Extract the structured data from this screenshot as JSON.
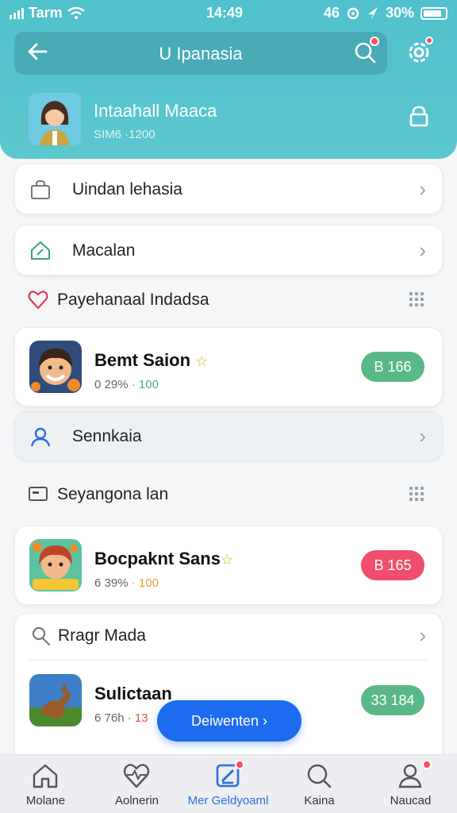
{
  "status_bar": {
    "carrier": "Tarm",
    "time": "14:49",
    "left_glyph": "46",
    "battery": "30%"
  },
  "header": {
    "title": "U Ipanasia"
  },
  "profile": {
    "name": "Intaahall Maaca",
    "sub": "SIM6 ·1200"
  },
  "menu": [
    {
      "label": "Uindan lehasia"
    },
    {
      "label": "Macalan"
    }
  ],
  "section_favorites": {
    "label": "Payehanaal Indadsa"
  },
  "app1": {
    "name": "Bemt Saion",
    "meta_pct": "0 29%",
    "meta_sep": "·",
    "meta_count": "100",
    "price": "B 166",
    "price_color": "#5ab888"
  },
  "search_row": {
    "label": "Sennkaia"
  },
  "section_second": {
    "label": "Seyangona lan"
  },
  "app2": {
    "name": "Bocpaknt Sans",
    "meta_pct": "6 39%",
    "meta_sep": "·",
    "meta_count": "100",
    "price": "B 165",
    "price_color": "#f04e6e"
  },
  "group": {
    "label": "Rragr Mada"
  },
  "app3": {
    "name": "Sulictaan",
    "meta_pct": "6 76h",
    "meta_sep": "·",
    "meta_count": "13",
    "price": "33 184",
    "price_color": "#5ab888"
  },
  "fab": {
    "label": "Deiwenten ›"
  },
  "bottom_nav": [
    {
      "label": "Molane"
    },
    {
      "label": "Aolnerin"
    },
    {
      "label": "Mer Geldyoaml"
    },
    {
      "label": "Kaina"
    },
    {
      "label": "Naucad"
    }
  ]
}
